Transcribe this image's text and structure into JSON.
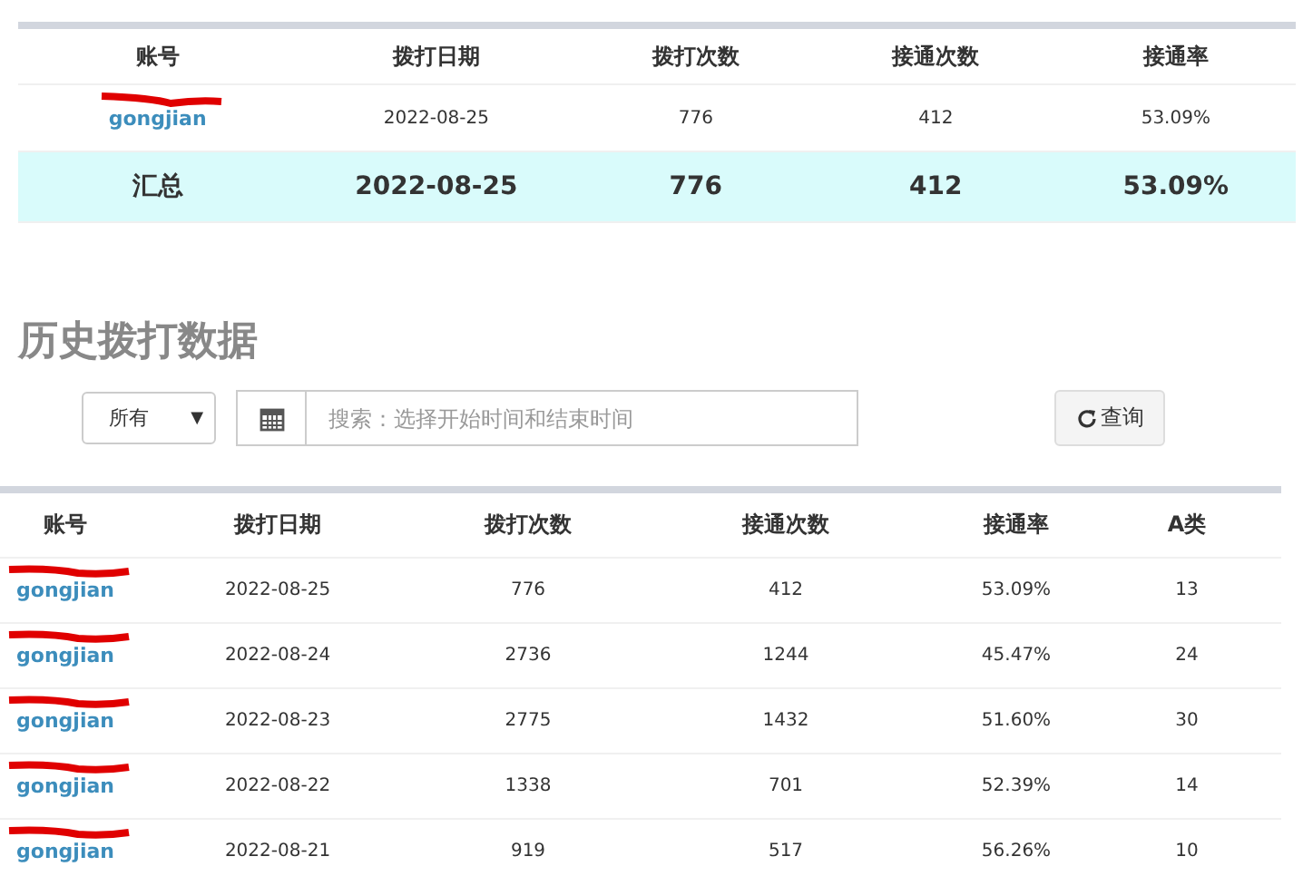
{
  "summary_table": {
    "columns": [
      "账号",
      "拨打日期",
      "拨打次数",
      "接通次数",
      "接通率"
    ],
    "rows": [
      [
        "gongjian",
        "2022-08-25",
        "776",
        "412",
        "53.09%"
      ]
    ],
    "total": [
      "汇总",
      "2022-08-25",
      "776",
      "412",
      "53.09%"
    ]
  },
  "history": {
    "title": "历史拨打数据",
    "filter": {
      "value": "所有",
      "caret": "▼"
    },
    "search": {
      "placeholder": "搜索：选择开始时间和结束时间"
    },
    "query_button": "查询",
    "columns": [
      "账号",
      "拨打日期",
      "拨打次数",
      "接通次数",
      "接通率",
      "A类"
    ],
    "rows": [
      [
        "gongjian",
        "2022-08-25",
        "776",
        "412",
        "53.09%",
        "13"
      ],
      [
        "gongjian",
        "2022-08-24",
        "2736",
        "1244",
        "45.47%",
        "24"
      ],
      [
        "gongjian",
        "2022-08-23",
        "2775",
        "1432",
        "51.60%",
        "30"
      ],
      [
        "gongjian",
        "2022-08-22",
        "1338",
        "701",
        "52.39%",
        "14"
      ],
      [
        "gongjian",
        "2022-08-21",
        "919",
        "517",
        "56.26%",
        "10"
      ]
    ]
  }
}
